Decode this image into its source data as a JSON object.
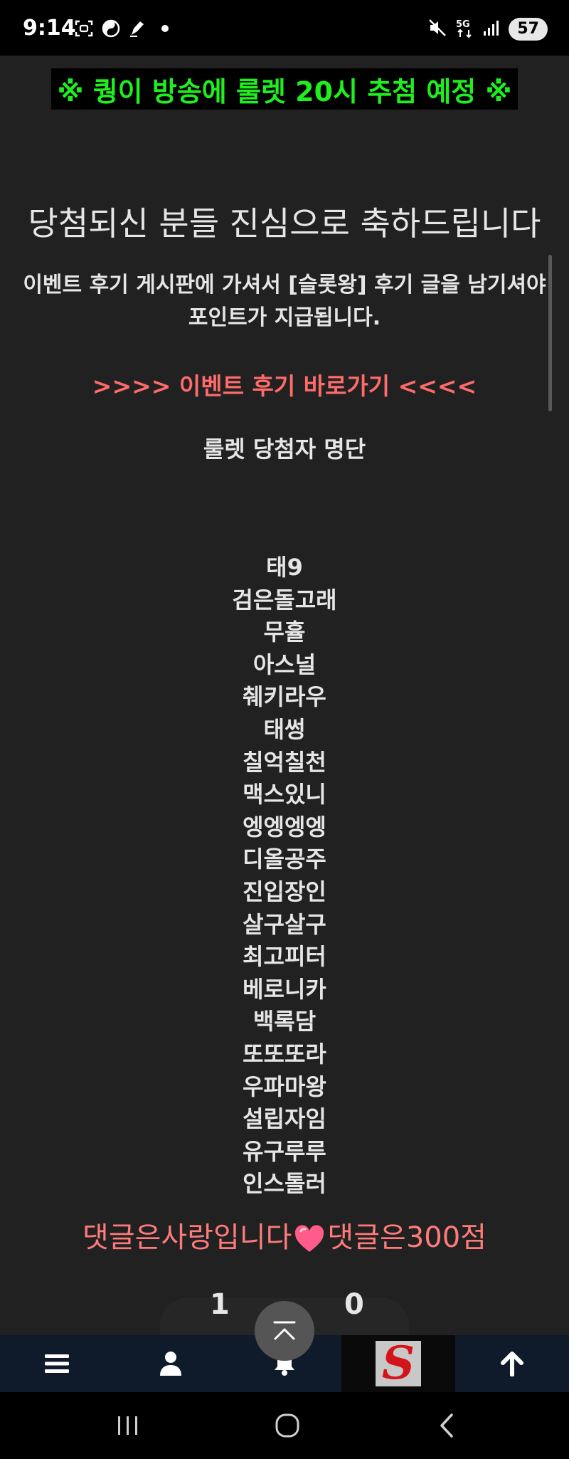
{
  "status_bar": {
    "time": "9:14",
    "battery": "57",
    "left_icons": [
      "screenshot-icon",
      "yin-yang-icon",
      "pen-icon",
      "dot-icon"
    ],
    "right_icons": [
      "mute-icon",
      "5g-icon",
      "signal-icon"
    ]
  },
  "content": {
    "banner": "※ 퀑이 방송에 룰렛 20시 추첨 예정 ※",
    "congrats": "당첨되신 분들 진심으로 축하드립니다",
    "instruction": "이벤트 후기 게시판에 가셔서 [슬롯왕] 후기 글을 남기셔야 포인트가 지급됩니다.",
    "event_link": ">>>> 이벤트 후기 바로가기 <<<<",
    "winners_title": "룰렛 당첨자 명단",
    "winners": [
      "태9",
      "검은돌고래",
      "무휼",
      "아스널",
      "췌키라우",
      "태썽",
      "칠억칠천",
      "맥스있니",
      "엥엥엥엥",
      "디올공주",
      "진입장인",
      "살구살구",
      "최고피터",
      "베로니카",
      "백록담",
      "또또또라",
      "우파마왕",
      "설립자임",
      "유구루루",
      "인스톨러"
    ],
    "comment_note_part1": "댓글은사랑입니다",
    "comment_note_part2": "댓글은300점",
    "vote_up": "1",
    "vote_down": "0"
  },
  "bottom_nav": {
    "logo_letter": "S",
    "items": [
      "menu-icon",
      "user-icon",
      "bell-icon",
      "site-logo",
      "arrow-up-icon"
    ]
  },
  "colors": {
    "banner_text": "#1ef01e",
    "link_text": "#ff6b6b",
    "page_bg": "#212121",
    "nav_bg": "#0f1a2b"
  }
}
